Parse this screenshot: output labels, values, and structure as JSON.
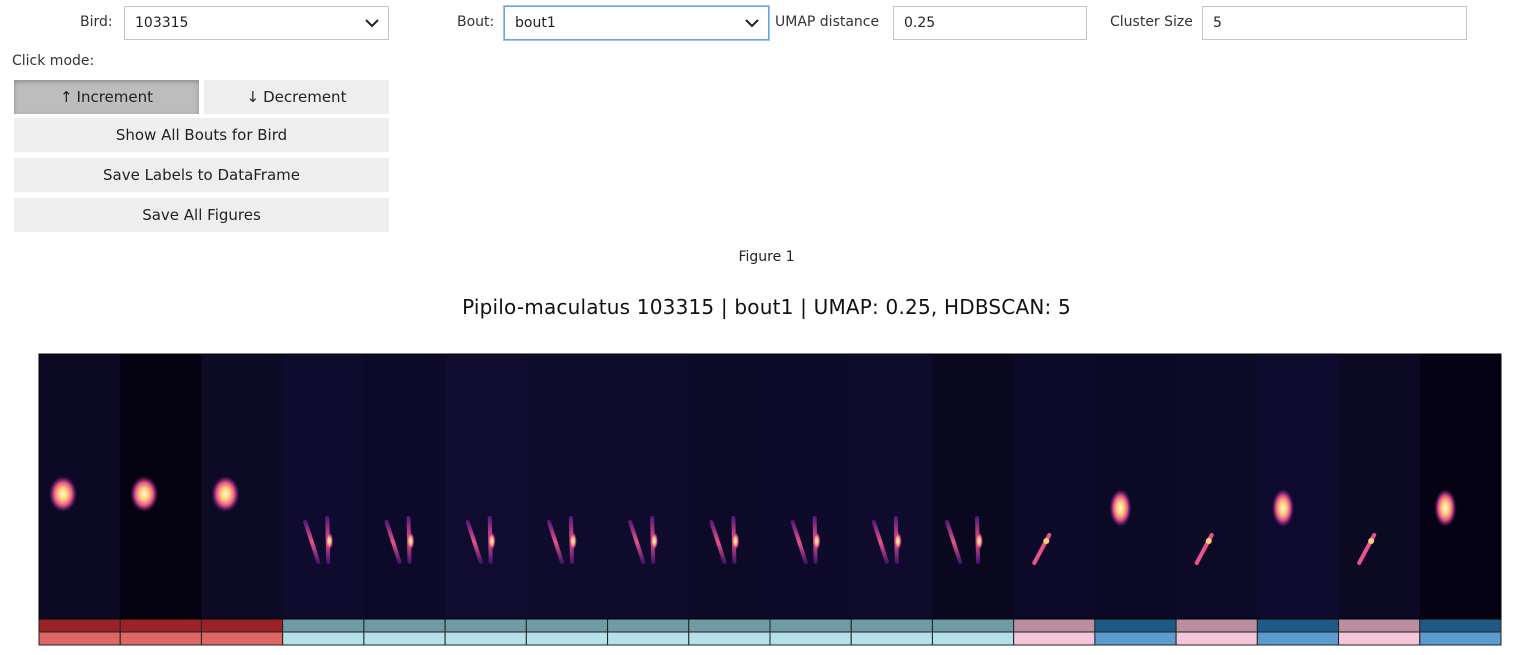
{
  "controls": {
    "bird_label": "Bird:",
    "bird_value": "103315",
    "bout_label": "Bout:",
    "bout_value": "bout1",
    "umap_label": "UMAP distance",
    "umap_value": "0.25",
    "cluster_label": "Cluster Size",
    "cluster_value": "5"
  },
  "click_mode": {
    "label": "Click mode:",
    "increment_arrow": "↑",
    "increment_label": "Increment",
    "decrement_arrow": "↓",
    "decrement_label": "Decrement",
    "active": "increment"
  },
  "buttons": {
    "show_all": "Show All Bouts for Bird",
    "save_labels": "Save Labels to DataFrame",
    "save_figures": "Save All Figures"
  },
  "figure": {
    "label": "Figure 1",
    "title": "Pipilo-maculatus 103315 | bout1 | UMAP: 0.25, HDBSCAN: 5"
  },
  "colors": {
    "dark_red": "#9b2226",
    "red": "#e06666",
    "dark_teal": "#6f9aa6",
    "light_blue": "#b3e2ea",
    "mauve": "#b88ea0",
    "pink": "#f5c6da",
    "dark_blue": "#1f5a86",
    "mid_blue": "#5b9bcf",
    "spec_bg": "#0c0a23"
  },
  "syllables": [
    {
      "cluster": 0,
      "shape": "blob-high"
    },
    {
      "cluster": 0,
      "shape": "blob-high"
    },
    {
      "cluster": 0,
      "shape": "blob-high"
    },
    {
      "cluster": 1,
      "shape": "double-stroke"
    },
    {
      "cluster": 1,
      "shape": "double-stroke"
    },
    {
      "cluster": 1,
      "shape": "double-stroke"
    },
    {
      "cluster": 1,
      "shape": "double-stroke"
    },
    {
      "cluster": 1,
      "shape": "double-stroke"
    },
    {
      "cluster": 1,
      "shape": "double-stroke"
    },
    {
      "cluster": 1,
      "shape": "double-stroke"
    },
    {
      "cluster": 1,
      "shape": "double-stroke"
    },
    {
      "cluster": 1,
      "shape": "double-stroke-long"
    },
    {
      "cluster": 2,
      "shape": "diag-short"
    },
    {
      "cluster": 3,
      "shape": "blob-mid"
    },
    {
      "cluster": 2,
      "shape": "diag-short"
    },
    {
      "cluster": 3,
      "shape": "blob-mid"
    },
    {
      "cluster": 2,
      "shape": "diag-short"
    },
    {
      "cluster": 3,
      "shape": "blob-mid"
    }
  ],
  "cluster_colors": [
    {
      "top": "#9b2226",
      "bottom": "#e06666"
    },
    {
      "top": "#6f9aa6",
      "bottom": "#b3e2ea"
    },
    {
      "top": "#b88ea0",
      "bottom": "#f5c6da"
    },
    {
      "top": "#1f5a86",
      "bottom": "#5b9bcf"
    }
  ]
}
